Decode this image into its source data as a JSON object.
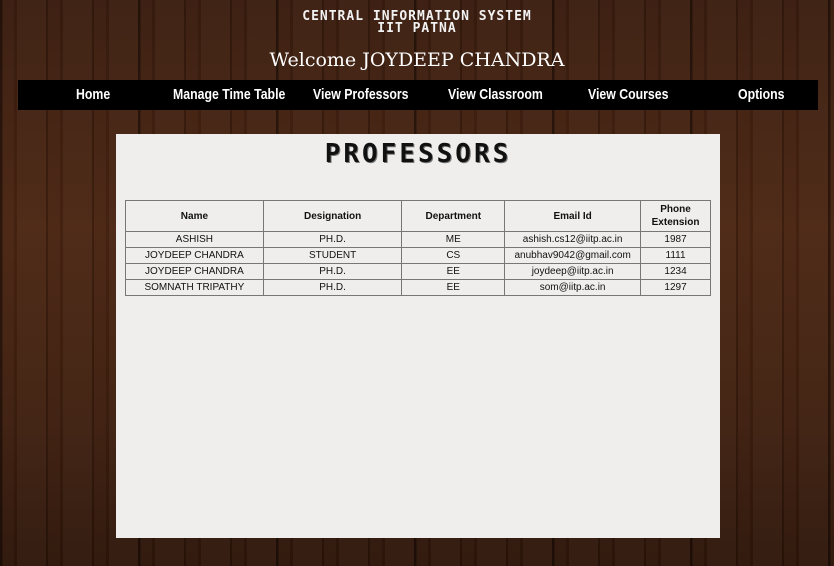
{
  "header": {
    "title_line1": "CENTRAL INFORMATION SYSTEM",
    "title_line2": "IIT PATNA",
    "welcome": "Welcome JOYDEEP CHANDRA"
  },
  "nav": {
    "items": [
      {
        "label": "Home"
      },
      {
        "label": "Manage Time Table"
      },
      {
        "label": "View Professors"
      },
      {
        "label": "View Classroom"
      },
      {
        "label": "View Courses"
      },
      {
        "label": "Options"
      }
    ]
  },
  "main": {
    "title": "PROFESSORS",
    "table": {
      "headers": [
        "Name",
        "Designation",
        "Department",
        "Email Id",
        "Phone Extension"
      ],
      "rows": [
        [
          "ASHISH",
          "PH.D.",
          "ME",
          "ashish.cs12@iitp.ac.in",
          "1987"
        ],
        [
          "JOYDEEP CHANDRA",
          "STUDENT",
          "CS",
          "anubhav9042@gmail.com",
          "1111"
        ],
        [
          "JOYDEEP CHANDRA",
          "PH.D.",
          "EE",
          "joydeep@iitp.ac.in",
          "1234"
        ],
        [
          "SOMNATH TRIPATHY",
          "PH.D.",
          "EE",
          "som@iitp.ac.in",
          "1297"
        ]
      ]
    }
  },
  "colors": {
    "navbar_bg": "#000000",
    "panel_bg": "#efeeed",
    "wood_bg": "#3e1f0f"
  }
}
